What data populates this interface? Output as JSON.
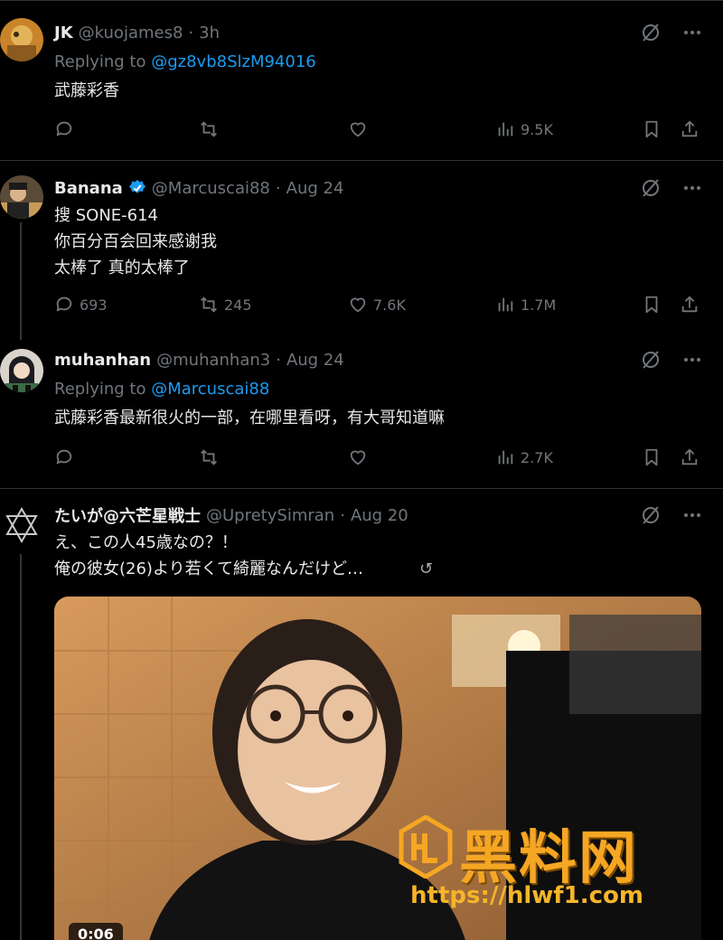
{
  "tweets": [
    {
      "name": "JK",
      "handle": "@kuojames8",
      "time": "3h",
      "replying_label": "Replying to",
      "replying_to": "@gz8vb8SlzM94016",
      "text": "武藤彩香",
      "replies": "",
      "retweets": "",
      "likes": "",
      "views": "9.5K"
    },
    {
      "name": "Banana",
      "verified": true,
      "handle": "@Marcuscai88",
      "time": "Aug 24",
      "text": "搜 SONE-614\n你百分百会回来感谢我\n太棒了 真的太棒了",
      "replies": "693",
      "retweets": "245",
      "likes": "7.6K",
      "views": "1.7M"
    },
    {
      "name": "muhanhan",
      "handle": "@muhanhan3",
      "time": "Aug 24",
      "replying_label": "Replying to",
      "replying_to": "@Marcuscai88",
      "text": "武藤彩香最新很火的一部，在哪里看呀，有大哥知道嘛",
      "replies": "",
      "retweets": "",
      "likes": "",
      "views": "2.7K"
    },
    {
      "name": "たいが@六芒星戦士",
      "handle": "@UpretySimran",
      "time": "Aug 20",
      "text": "え、この人45歳なの？！\n俺の彼女(26)より若くて綺麗なんだけど… ",
      "video_duration": "0:06"
    }
  ],
  "watermark": {
    "brand": "黑料网",
    "url": "https://hlwf1.com"
  },
  "colors": {
    "background": "#000000",
    "text": "#e7e9ea",
    "muted": "#71767b",
    "link": "#1d9bf0",
    "verified": "#1d9bf0",
    "watermark": "#f5a623"
  }
}
